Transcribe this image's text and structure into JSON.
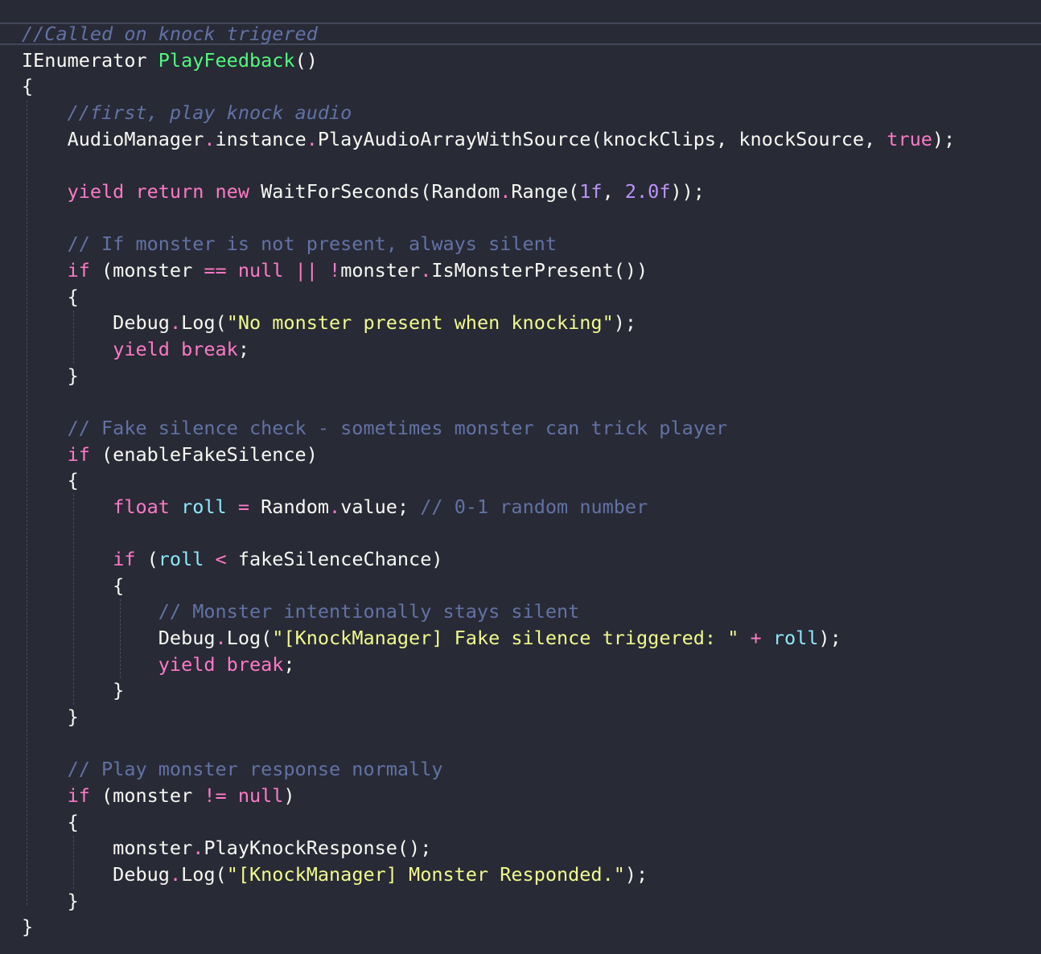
{
  "editor": {
    "language": "C#",
    "theme": "dark",
    "colors": {
      "background": "#282a36",
      "text": "#f8f8f2",
      "comment": "#6272a4",
      "keyword": "#ff79c6",
      "function": "#50fa7b",
      "string": "#f1fa8c",
      "number": "#bd93f9",
      "variable": "#8be9fd"
    },
    "lines": [
      [
        [
          "//Called on knock trigered",
          "comment italic"
        ]
      ],
      [
        [
          "IEnumerator ",
          "plain"
        ],
        [
          "PlayFeedback",
          "func"
        ],
        [
          "()",
          "plain"
        ]
      ],
      [
        [
          "{",
          "plain"
        ]
      ],
      [
        [
          "    ",
          "plain"
        ],
        [
          "//first, play knock audio",
          "comment italic"
        ]
      ],
      [
        [
          "    AudioManager",
          "plain"
        ],
        [
          ".",
          "op"
        ],
        [
          "instance",
          "plain"
        ],
        [
          ".",
          "op"
        ],
        [
          "PlayAudioArrayWithSource(knockClips, knockSource, ",
          "plain"
        ],
        [
          "true",
          "keyword"
        ],
        [
          ");",
          "plain"
        ]
      ],
      [
        [
          "",
          "plain"
        ]
      ],
      [
        [
          "    ",
          "plain"
        ],
        [
          "yield return new",
          "keyword"
        ],
        [
          " WaitForSeconds(Random",
          "plain"
        ],
        [
          ".",
          "op"
        ],
        [
          "Range(",
          "plain"
        ],
        [
          "1f",
          "number"
        ],
        [
          ", ",
          "plain"
        ],
        [
          "2.0f",
          "number"
        ],
        [
          "));",
          "plain"
        ]
      ],
      [
        [
          "",
          "plain"
        ]
      ],
      [
        [
          "    ",
          "plain"
        ],
        [
          "// If monster is not present, always silent",
          "comment"
        ]
      ],
      [
        [
          "    ",
          "plain"
        ],
        [
          "if",
          "keyword"
        ],
        [
          " (monster ",
          "plain"
        ],
        [
          "==",
          "op"
        ],
        [
          " ",
          "plain"
        ],
        [
          "null",
          "keyword"
        ],
        [
          " ",
          "plain"
        ],
        [
          "||",
          "op"
        ],
        [
          " ",
          "plain"
        ],
        [
          "!",
          "op"
        ],
        [
          "monster",
          "plain"
        ],
        [
          ".",
          "op"
        ],
        [
          "IsMonsterPresent())",
          "plain"
        ]
      ],
      [
        [
          "    {",
          "plain"
        ]
      ],
      [
        [
          "        Debug",
          "plain"
        ],
        [
          ".",
          "op"
        ],
        [
          "Log(",
          "plain"
        ],
        [
          "\"No monster present when knocking\"",
          "string"
        ],
        [
          ");",
          "plain"
        ]
      ],
      [
        [
          "        ",
          "plain"
        ],
        [
          "yield break",
          "keyword"
        ],
        [
          ";",
          "plain"
        ]
      ],
      [
        [
          "    }",
          "plain"
        ]
      ],
      [
        [
          "",
          "plain"
        ]
      ],
      [
        [
          "    ",
          "plain"
        ],
        [
          "// Fake silence check - sometimes monster can trick player",
          "comment"
        ]
      ],
      [
        [
          "    ",
          "plain"
        ],
        [
          "if",
          "keyword"
        ],
        [
          " (enableFakeSilence)",
          "plain"
        ]
      ],
      [
        [
          "    {",
          "plain"
        ]
      ],
      [
        [
          "        ",
          "plain"
        ],
        [
          "float",
          "keyword"
        ],
        [
          " ",
          "plain"
        ],
        [
          "roll",
          "param"
        ],
        [
          " ",
          "plain"
        ],
        [
          "=",
          "op"
        ],
        [
          " Random",
          "plain"
        ],
        [
          ".",
          "op"
        ],
        [
          "value; ",
          "plain"
        ],
        [
          "// 0-1 random number",
          "comment"
        ]
      ],
      [
        [
          "",
          "plain"
        ]
      ],
      [
        [
          "        ",
          "plain"
        ],
        [
          "if",
          "keyword"
        ],
        [
          " (",
          "plain"
        ],
        [
          "roll",
          "param"
        ],
        [
          " ",
          "plain"
        ],
        [
          "<",
          "op"
        ],
        [
          " fakeSilenceChance)",
          "plain"
        ]
      ],
      [
        [
          "        {",
          "plain"
        ]
      ],
      [
        [
          "            ",
          "plain"
        ],
        [
          "// Monster intentionally stays silent",
          "comment"
        ]
      ],
      [
        [
          "            Debug",
          "plain"
        ],
        [
          ".",
          "op"
        ],
        [
          "Log(",
          "plain"
        ],
        [
          "\"[KnockManager] Fake silence triggered: \"",
          "string"
        ],
        [
          " ",
          "plain"
        ],
        [
          "+",
          "op"
        ],
        [
          " ",
          "plain"
        ],
        [
          "roll",
          "param"
        ],
        [
          ");",
          "plain"
        ]
      ],
      [
        [
          "            ",
          "plain"
        ],
        [
          "yield break",
          "keyword"
        ],
        [
          ";",
          "plain"
        ]
      ],
      [
        [
          "        }",
          "plain"
        ]
      ],
      [
        [
          "    }",
          "plain"
        ]
      ],
      [
        [
          "",
          "plain"
        ]
      ],
      [
        [
          "    ",
          "plain"
        ],
        [
          "// Play monster response normally",
          "comment"
        ]
      ],
      [
        [
          "    ",
          "plain"
        ],
        [
          "if",
          "keyword"
        ],
        [
          " (monster ",
          "plain"
        ],
        [
          "!=",
          "op"
        ],
        [
          " ",
          "plain"
        ],
        [
          "null",
          "keyword"
        ],
        [
          ")",
          "plain"
        ]
      ],
      [
        [
          "    {",
          "plain"
        ]
      ],
      [
        [
          "        monster",
          "plain"
        ],
        [
          ".",
          "op"
        ],
        [
          "PlayKnockResponse();",
          "plain"
        ]
      ],
      [
        [
          "        Debug",
          "plain"
        ],
        [
          ".",
          "op"
        ],
        [
          "Log(",
          "plain"
        ],
        [
          "\"[KnockManager] Monster Responded.\"",
          "string"
        ],
        [
          ");",
          "plain"
        ]
      ],
      [
        [
          "    }",
          "plain"
        ]
      ],
      [
        [
          "}",
          "plain"
        ]
      ]
    ]
  }
}
